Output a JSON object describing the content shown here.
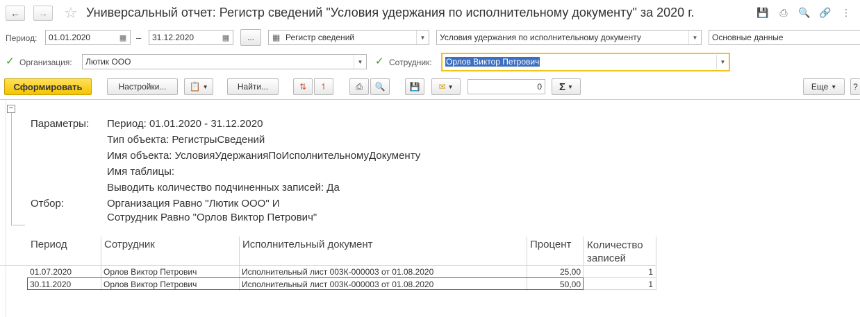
{
  "window": {
    "title": "Универсальный отчет: Регистр сведений \"Условия удержания по исполнительному документу\" за 2020 г."
  },
  "filters": {
    "period_label": "Период:",
    "period_from": "01.01.2020",
    "period_dash": "–",
    "period_to": "31.12.2020",
    "ellipsis_label": "...",
    "object_type": "Регистр сведений",
    "object_name": "Условия удержания по исполнительному документу",
    "table_name": "Основные данные",
    "org_label": "Организация:",
    "org_value": "Лютик ООО",
    "employee_label": "Сотрудник:",
    "employee_value": "Орлов Виктор Петрович"
  },
  "toolbar": {
    "generate_label": "Сформировать",
    "settings_label": "Настройки...",
    "find_label": "Найти...",
    "sum_value": "0",
    "more_label": "Еще"
  },
  "report": {
    "params_label": "Параметры:",
    "params": [
      "Период: 01.01.2020 - 31.12.2020",
      "Тип объекта: РегистрыСведений",
      "Имя объекта: УсловияУдержанияПоИсполнительномуДокументу",
      "Имя таблицы:",
      "Выводить количество подчиненных записей: Да"
    ],
    "filter_label": "Отбор:",
    "filter_lines": [
      "Организация Равно \"Лютик ООО\" И",
      "Сотрудник Равно \"Орлов Виктор Петрович\""
    ],
    "columns": [
      "Период",
      "Сотрудник",
      "Исполнительный документ",
      "Процент",
      "Количество записей"
    ],
    "rows": [
      [
        "01.07.2020",
        "Орлов Виктор Петрович",
        "Исполнительный лист 003К-000003 от 01.08.2020",
        "25,00",
        "1"
      ],
      [
        "30.11.2020",
        "Орлов Виктор Петрович",
        "Исполнительный лист 003К-000003 от 01.08.2020",
        "50,00",
        "1"
      ]
    ]
  },
  "colors": {
    "accent_yellow": "#f5c400",
    "selection_blue": "#3d6fc0",
    "highlight_red": "#d9262c",
    "check_green": "#3a9a1f"
  }
}
